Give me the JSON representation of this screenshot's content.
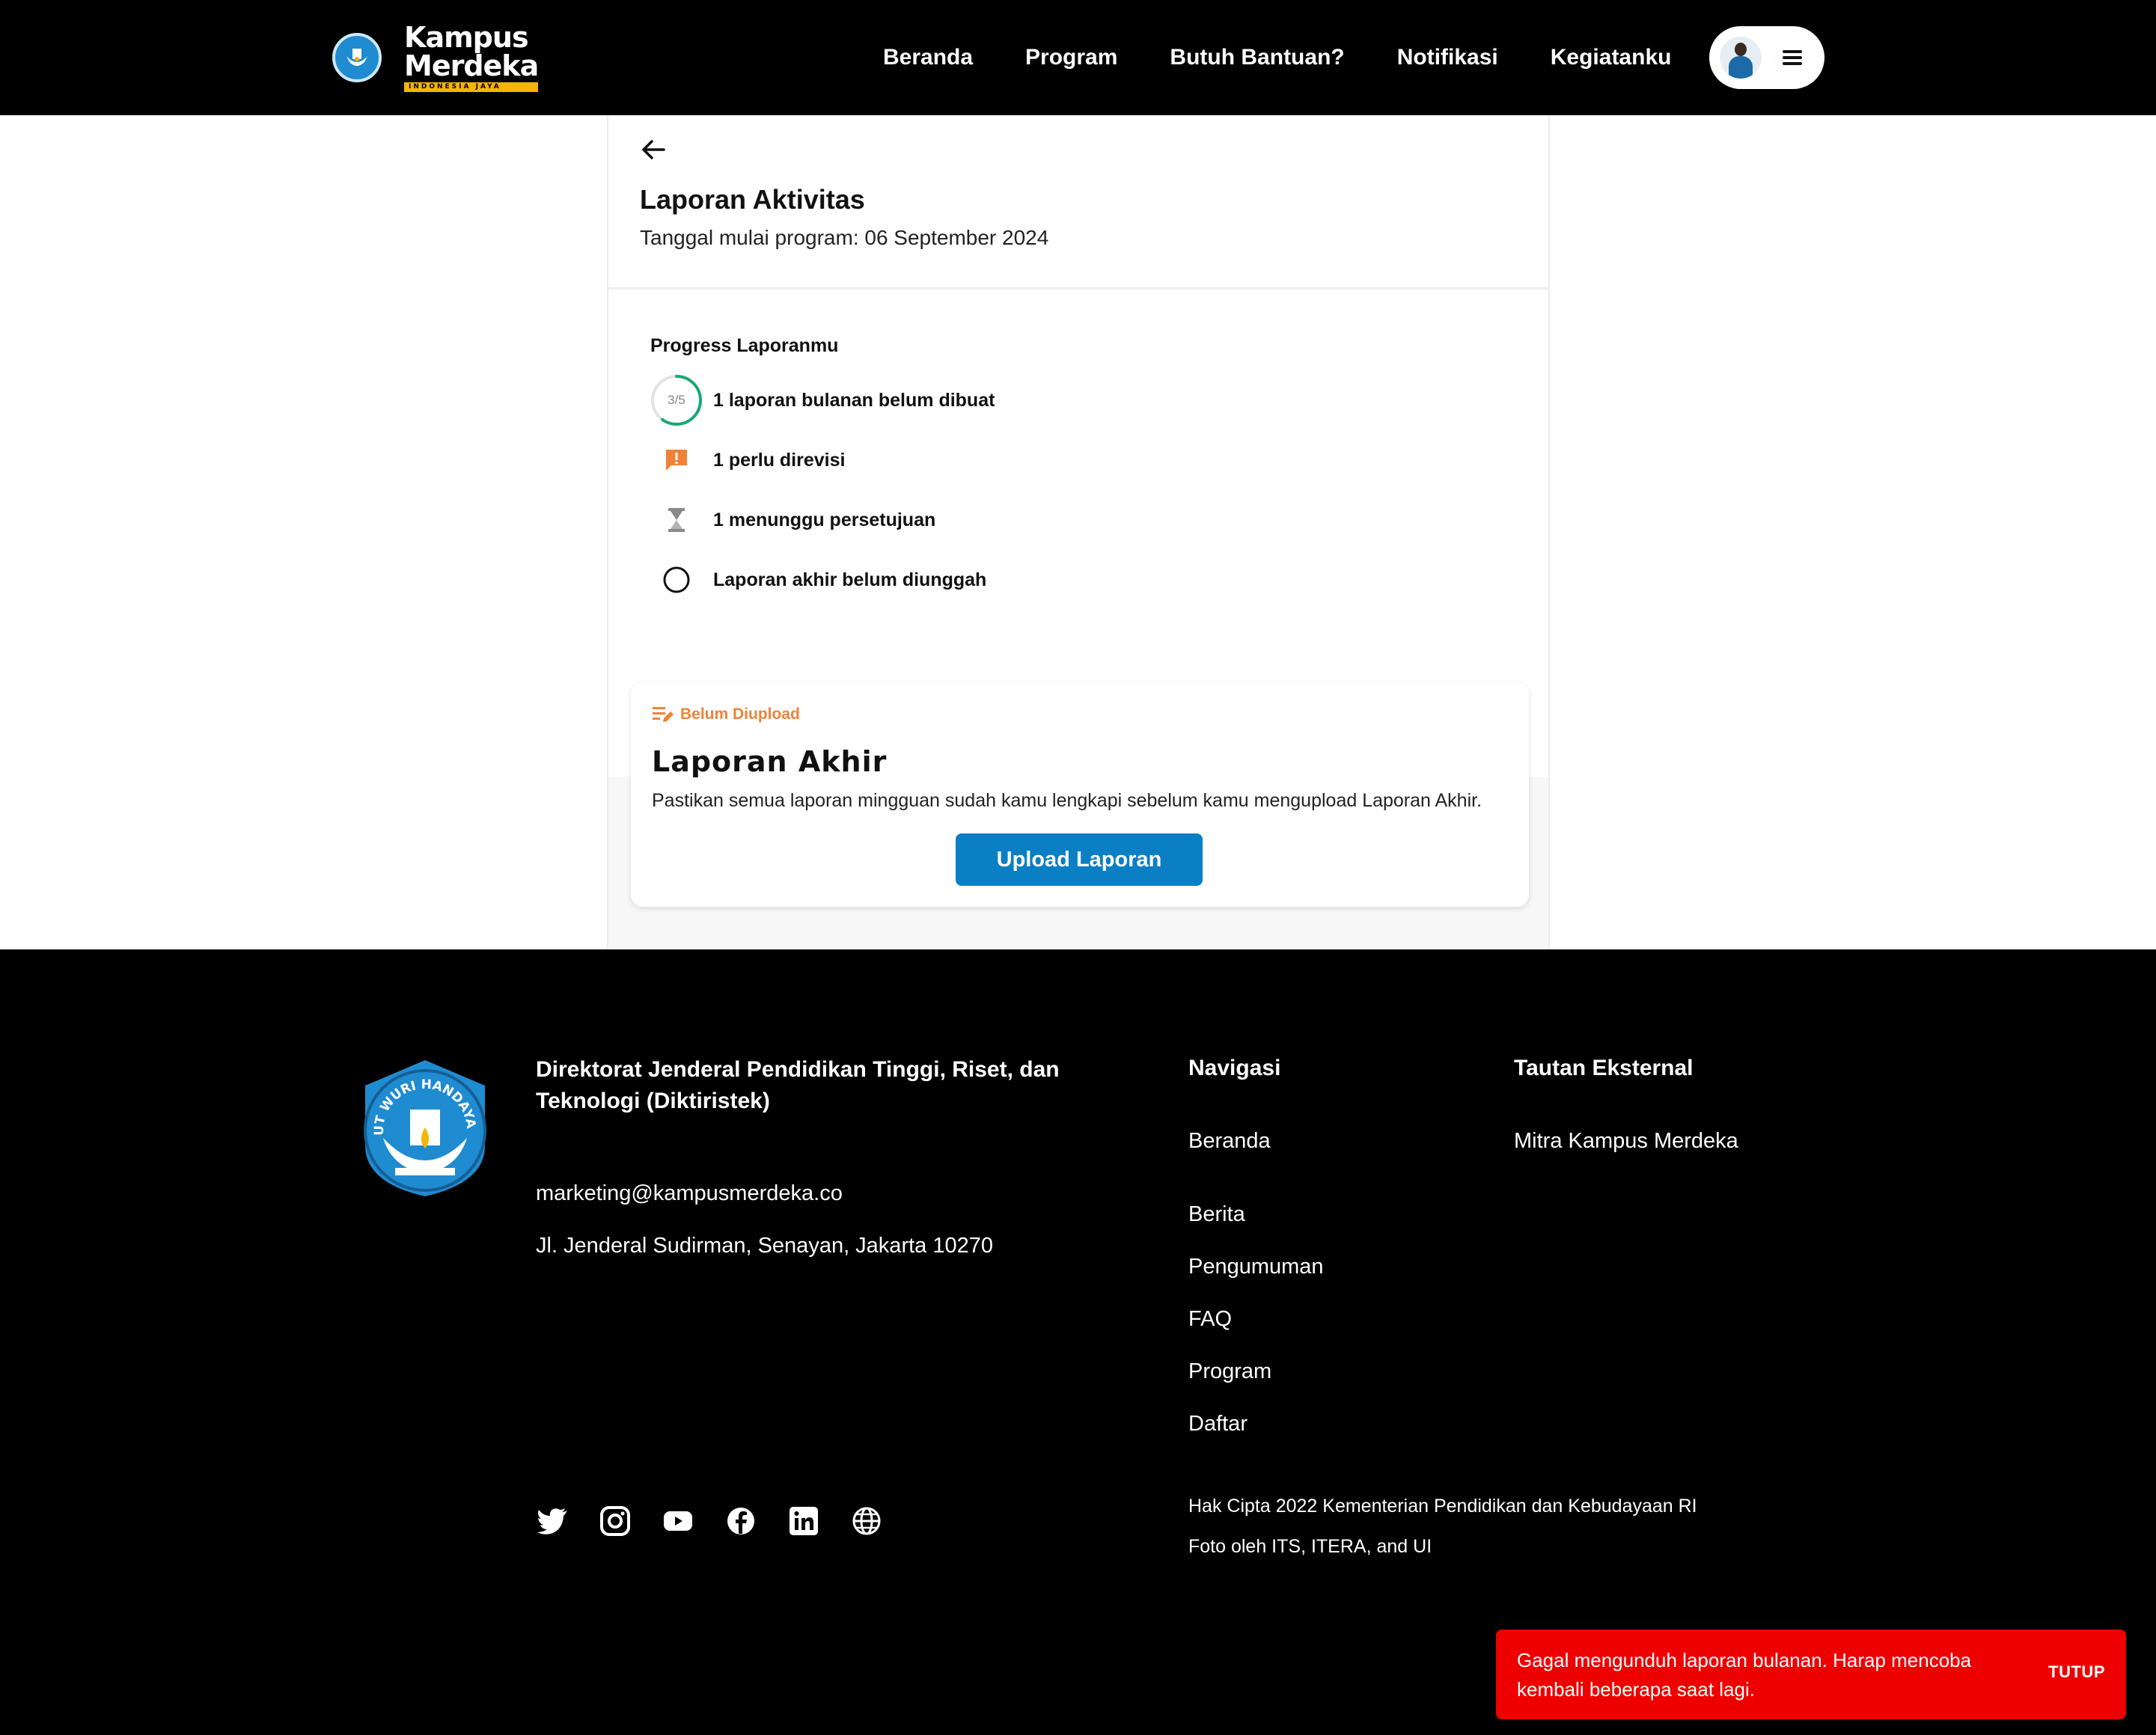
{
  "navbar": {
    "brand": {
      "line1": "Kampus",
      "line2": "Merdeka",
      "tagline": "INDONESIA JAYA"
    },
    "links": [
      "Beranda",
      "Program",
      "Butuh Bantuan?",
      "Notifikasi",
      "Kegiatanku"
    ]
  },
  "report": {
    "title": "Laporan Aktivitas",
    "start_date": "Tanggal mulai program: 06 September 2024"
  },
  "progress": {
    "title": "Progress Laporanmu",
    "ring_label": "3/5",
    "ring_fraction": 0.6,
    "items": [
      "1 laporan bulanan belum dibuat",
      "1 perlu direvisi",
      "1 menunggu persetujuan",
      "Laporan akhir belum diunggah"
    ]
  },
  "final_report": {
    "status": "Belum Diupload",
    "title": "Laporan Akhir",
    "description": "Pastikan semua laporan mingguan sudah kamu lengkapi sebelum kamu mengupload Laporan Akhir.",
    "button": "Upload Laporan"
  },
  "footer": {
    "org_name": "Direktorat Jenderal Pendidikan Tinggi, Riset, dan Teknologi (Diktiristek)",
    "email": "marketing@kampusmerdeka.co",
    "address": "Jl. Jenderal Sudirman, Senayan, Jakarta 10270",
    "nav_heading": "Navigasi",
    "nav_links": [
      "Beranda",
      "Berita",
      "Pengumuman",
      "FAQ",
      "Program",
      "Daftar"
    ],
    "external_heading": "Tautan Eksternal",
    "external_links": [
      "Mitra Kampus Merdeka"
    ],
    "copyright": "Hak Cipta 2022 Kementerian Pendidikan dan Kebudayaan RI",
    "credit": "Foto oleh ITS, ITERA, and UI",
    "emblem_text": "TUT WURI HANDAYANI",
    "socials": [
      "twitter-icon",
      "instagram-icon",
      "youtube-icon",
      "facebook-icon",
      "linkedin-icon",
      "website-icon"
    ]
  },
  "toast": {
    "message": "Gagal mengunduh laporan bulanan. Harap mencoba kembali beberapa saat lagi.",
    "close": "TUTUP"
  },
  "colors": {
    "accent": "#0a7fc4",
    "progress_green": "#19a974",
    "warning_orange": "#f08238",
    "error_red": "#ee0000"
  }
}
